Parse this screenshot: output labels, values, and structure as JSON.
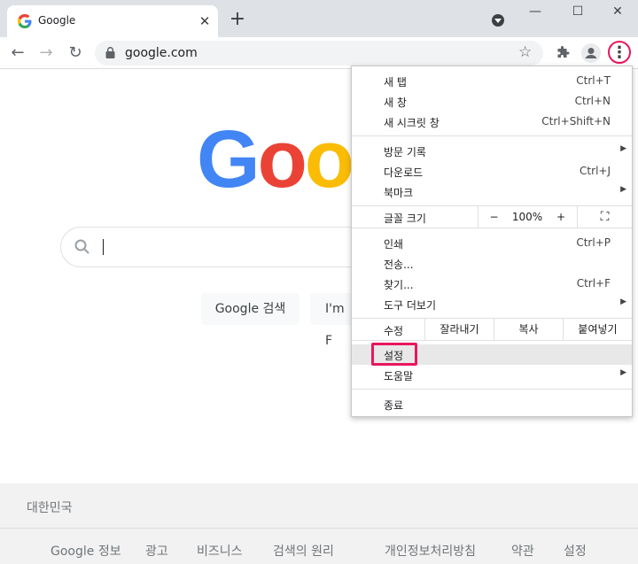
{
  "tab": {
    "title": "Google",
    "close": "✕"
  },
  "new_tab": "+",
  "window": {
    "minimize": "—",
    "maximize": "☐",
    "close": "✕"
  },
  "toolbar": {
    "back": "←",
    "forward": "→",
    "reload": "↻",
    "url": "google.com",
    "star": "☆",
    "extensions": "⋯",
    "menu": "⋮"
  },
  "page": {
    "logo_letters": [
      {
        "ch": "G",
        "color": "#4285f4"
      },
      {
        "ch": "o",
        "color": "#ea4335"
      },
      {
        "ch": "o",
        "color": "#fbbc05"
      }
    ],
    "search_button": "Google 검색",
    "lucky_button": "I'm F",
    "country": "대한민국",
    "footer_links": [
      "Google 정보",
      "광고",
      "비즈니스",
      "검색의 원리",
      "개인정보처리방침",
      "약관",
      "설정"
    ]
  },
  "menu": {
    "items_top": [
      {
        "label": "새 탭",
        "shortcut": "Ctrl+T"
      },
      {
        "label": "새 창",
        "shortcut": "Ctrl+N"
      },
      {
        "label": "새 시크릿 창",
        "shortcut": "Ctrl+Shift+N"
      }
    ],
    "items_mid": [
      {
        "label": "방문 기록",
        "shortcut": "",
        "arrow": "▶"
      },
      {
        "label": "다운로드",
        "shortcut": "Ctrl+J",
        "arrow": ""
      },
      {
        "label": "북마크",
        "shortcut": "",
        "arrow": "▶"
      }
    ],
    "zoom": {
      "label": "글꼴 크기",
      "minus": "−",
      "value": "100%",
      "plus": "+",
      "fullscreen": "⛶"
    },
    "items_tools": [
      {
        "label": "인쇄",
        "shortcut": "Ctrl+P",
        "arrow": ""
      },
      {
        "label": "전송...",
        "shortcut": "",
        "arrow": ""
      },
      {
        "label": "찾기...",
        "shortcut": "Ctrl+F",
        "arrow": ""
      },
      {
        "label": "도구 더보기",
        "shortcut": "",
        "arrow": "▶"
      }
    ],
    "edit": {
      "label": "수정",
      "cut": "잘라내기",
      "copy": "복사",
      "paste": "붙여넣기"
    },
    "settings": "설정",
    "help": {
      "label": "도움말",
      "arrow": "▶"
    },
    "exit": "종료"
  },
  "colors": {
    "highlight_ring": "#e8175d",
    "tabstrip": "#dee1e6"
  }
}
